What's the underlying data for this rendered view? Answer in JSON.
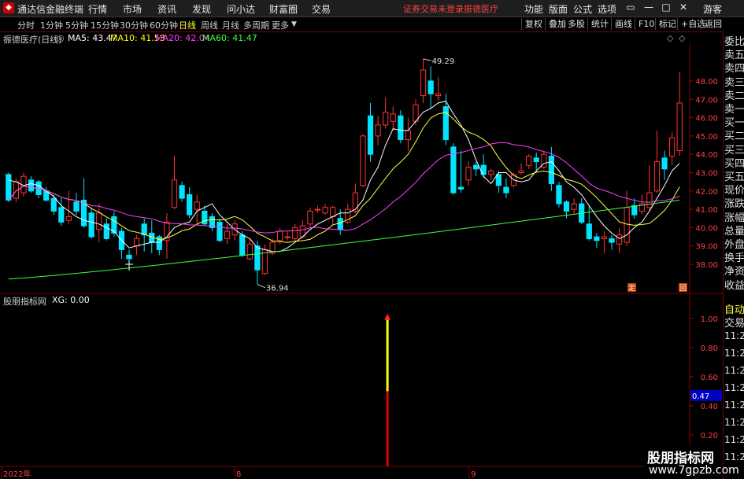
{
  "titlebar": {
    "app_name": "通达信金融终端",
    "menus": [
      "行情",
      "市场",
      "资讯",
      "发现",
      "问小达",
      "财富圈",
      "交易"
    ],
    "warning": "证券交易未登录",
    "stock_name": "振德医疗",
    "right_menus": [
      "功能",
      "版面",
      "公式",
      "选项"
    ],
    "user": "游客"
  },
  "tabs": {
    "periods": [
      "分时",
      "1分钟",
      "5分钟",
      "15分钟",
      "30分钟",
      "60分钟",
      "日线",
      "周线",
      "月线",
      "多周期",
      "更多"
    ],
    "active": "日线",
    "buttons": [
      "复权",
      "叠加",
      "多股",
      "统计",
      "画线",
      "F10",
      "标记",
      "+自选",
      "返回"
    ]
  },
  "main_chart": {
    "stock_title": "振德医疗(日线)",
    "ma": [
      {
        "label": "MA5: 43.47",
        "color": "#ffffff"
      },
      {
        "label": "MA10: 41.53",
        "color": "#ffff00"
      },
      {
        "label": "MA20: 42.04",
        "color": "#ff40ff"
      },
      {
        "label": "MA60: 41.47",
        "color": "#40ff40"
      }
    ],
    "high_label": "49.29",
    "low_label": "36.94",
    "badges": [
      "定",
      "回"
    ]
  },
  "sub_chart": {
    "title": "股朋指标网",
    "value_label": "XG: 0.00",
    "current_value": "0.47"
  },
  "date_axis": {
    "labels": [
      "2022年",
      "8",
      "9"
    ]
  },
  "right_panel": {
    "items": [
      "委比",
      "卖五",
      "卖四",
      "卖三",
      "卖二",
      "卖一",
      "买一",
      "买二",
      "买三",
      "买四",
      "买五",
      "现价",
      "涨跌",
      "涨幅",
      "总量",
      "外盘",
      "换手",
      "净资",
      "收益"
    ],
    "section_labels": [
      "自动",
      "交易"
    ],
    "times": [
      "11:29",
      "11:29",
      "11:29",
      "11:29",
      "11:29",
      "11:29",
      "11:29",
      "11:29"
    ]
  },
  "watermark": {
    "line1": "股朋指标网",
    "line2": "www.7gpzb.com"
  },
  "chart_data": [
    {
      "type": "candlestick",
      "title": "振德医疗(日线)",
      "y_ticks": [
        38.0,
        39.0,
        40.0,
        41.0,
        42.0,
        43.0,
        44.0,
        45.0,
        46.0,
        47.0,
        48.0
      ],
      "ylim": [
        36.5,
        49.8
      ],
      "candles": [
        [
          42.9,
          41.5,
          43.0,
          41.4
        ],
        [
          41.6,
          42.5,
          42.7,
          41.4
        ],
        [
          41.9,
          42.8,
          43.0,
          41.7
        ],
        [
          42.6,
          42.0,
          42.8,
          41.9
        ],
        [
          42.5,
          41.8,
          42.6,
          41.6
        ],
        [
          42.0,
          41.5,
          42.2,
          41.4
        ],
        [
          41.6,
          40.9,
          41.8,
          40.7
        ],
        [
          41.1,
          40.3,
          41.6,
          40.1
        ],
        [
          40.4,
          40.6,
          42.0,
          40.2
        ],
        [
          41.4,
          40.9,
          41.9,
          40.7
        ],
        [
          41.5,
          40.1,
          42.7,
          40.0
        ],
        [
          40.8,
          39.5,
          41.1,
          39.4
        ],
        [
          39.9,
          40.8,
          41.3,
          39.2
        ],
        [
          40.2,
          39.4,
          40.5,
          39.3
        ],
        [
          40.6,
          39.7,
          40.9,
          39.5
        ],
        [
          39.8,
          38.8,
          40.0,
          38.3
        ],
        [
          38.5,
          38.3,
          38.8,
          38.0
        ],
        [
          39.0,
          39.4,
          39.6,
          38.5
        ],
        [
          40.2,
          39.6,
          40.5,
          38.7
        ],
        [
          39.7,
          39.2,
          40.4,
          38.6
        ],
        [
          39.5,
          38.8,
          39.6,
          38.5
        ],
        [
          39.3,
          40.3,
          40.8,
          38.3
        ],
        [
          41.1,
          42.6,
          43.9,
          41.0
        ],
        [
          42.3,
          41.6,
          42.5,
          41.4
        ],
        [
          41.8,
          40.7,
          42.2,
          40.5
        ],
        [
          41.0,
          41.4,
          41.8,
          40.2
        ],
        [
          40.9,
          40.2,
          41.2,
          40.1
        ],
        [
          40.6,
          40.0,
          40.8,
          39.8
        ],
        [
          40.3,
          39.3,
          40.5,
          39.2
        ],
        [
          39.4,
          39.8,
          40.2,
          39.1
        ],
        [
          39.6,
          40.2,
          40.4,
          39.3
        ],
        [
          39.6,
          38.5,
          39.8,
          38.4
        ],
        [
          38.3,
          39.1,
          39.4,
          38.2
        ],
        [
          39.0,
          37.7,
          39.3,
          36.9
        ],
        [
          37.5,
          38.8,
          39.1,
          37.4
        ],
        [
          38.6,
          39.2,
          39.4,
          38.5
        ],
        [
          39.3,
          39.8,
          40.0,
          39.1
        ],
        [
          39.5,
          39.5,
          39.8,
          39.3
        ],
        [
          39.4,
          40.0,
          40.2,
          39.2
        ],
        [
          39.5,
          40.1,
          40.4,
          39.4
        ],
        [
          40.2,
          40.9,
          41.1,
          40.0
        ],
        [
          41.0,
          41.0,
          41.2,
          40.8
        ],
        [
          40.8,
          41.1,
          41.3,
          40.7
        ],
        [
          40.6,
          41.1,
          41.2,
          40.1
        ],
        [
          40.5,
          39.9,
          41.0,
          39.6
        ],
        [
          40.3,
          41.0,
          41.3,
          40.2
        ],
        [
          40.9,
          41.9,
          42.4,
          40.8
        ],
        [
          42.3,
          45.0,
          45.1,
          42.2
        ],
        [
          46.1,
          44.0,
          46.8,
          43.6
        ],
        [
          45.0,
          45.6,
          46.1,
          44.5
        ],
        [
          45.6,
          46.3,
          47.1,
          45.4
        ],
        [
          45.8,
          46.2,
          46.6,
          45.3
        ],
        [
          46.1,
          44.8,
          46.4,
          44.6
        ],
        [
          44.8,
          45.3,
          46.0,
          44.2
        ],
        [
          45.8,
          46.7,
          47.0,
          45.6
        ],
        [
          47.2,
          48.6,
          49.2,
          46.8
        ],
        [
          48.0,
          47.3,
          48.8,
          46.5
        ],
        [
          47.2,
          47.3,
          48.2,
          46.9
        ],
        [
          46.6,
          44.8,
          47.3,
          44.5
        ],
        [
          44.4,
          41.9,
          44.6,
          41.8
        ],
        [
          42.2,
          42.1,
          44.2,
          41.9
        ],
        [
          42.6,
          43.3,
          43.6,
          42.3
        ],
        [
          43.4,
          43.2,
          43.6,
          42.8
        ],
        [
          43.4,
          42.9,
          44.0,
          42.7
        ],
        [
          42.9,
          43.1,
          43.2,
          42.6
        ],
        [
          42.9,
          42.3,
          43.1,
          41.9
        ],
        [
          42.2,
          41.9,
          42.7,
          41.6
        ],
        [
          42.3,
          42.9,
          43.0,
          42.2
        ],
        [
          43.0,
          43.1,
          43.5,
          42.9
        ],
        [
          43.4,
          43.9,
          44.0,
          43.2
        ],
        [
          43.8,
          43.6,
          44.1,
          43.0
        ],
        [
          43.3,
          44.0,
          44.2,
          43.2
        ],
        [
          43.9,
          42.4,
          44.4,
          42.0
        ],
        [
          42.3,
          41.3,
          42.5,
          41.1
        ],
        [
          41.4,
          40.9,
          41.5,
          40.5
        ],
        [
          41.0,
          41.3,
          41.6,
          40.7
        ],
        [
          41.3,
          40.3,
          41.6,
          40.2
        ],
        [
          40.2,
          39.4,
          41.2,
          39.3
        ],
        [
          39.5,
          39.3,
          39.7,
          38.9
        ],
        [
          39.4,
          39.5,
          39.8,
          38.6
        ],
        [
          39.4,
          39.2,
          39.6,
          38.8
        ],
        [
          39.1,
          39.6,
          40.0,
          38.6
        ],
        [
          39.2,
          41.1,
          42.0,
          39.0
        ],
        [
          41.2,
          40.7,
          41.6,
          40.5
        ],
        [
          40.9,
          41.3,
          41.8,
          40.7
        ],
        [
          41.1,
          41.9,
          43.4,
          40.9
        ],
        [
          42.0,
          43.6,
          45.3,
          41.9
        ],
        [
          43.8,
          43.2,
          44.2,
          42.6
        ],
        [
          43.9,
          44.9,
          45.2,
          43.4
        ],
        [
          44.2,
          46.8,
          48.5,
          43.9
        ]
      ],
      "ma_values": {
        "MA5": [
          42.6,
          42.5,
          42.3,
          42.4,
          42.3,
          42.0,
          41.7,
          41.2,
          40.9,
          40.6,
          40.4,
          40.3,
          40.2,
          40.0,
          39.8,
          39.3,
          38.9,
          39.0,
          39.1,
          39.2,
          39.2,
          39.5,
          40.0,
          40.2,
          40.3,
          40.9,
          41.1,
          41.3,
          40.7,
          40.3,
          39.9,
          39.6,
          39.4,
          38.9,
          38.8,
          38.7,
          38.7,
          38.9,
          39.2,
          39.5,
          39.9,
          40.2,
          40.4,
          40.6,
          40.8,
          40.8,
          41.0,
          41.5,
          42.6,
          43.3,
          44.5,
          45.4,
          45.3,
          45.3,
          45.8,
          46.3,
          46.5,
          46.8,
          46.9,
          46.2,
          45.6,
          44.8,
          43.7,
          42.8,
          42.4,
          43.0,
          43.0,
          42.6,
          42.5,
          42.6,
          43.1,
          43.5,
          43.6,
          43.1,
          42.5,
          42.2,
          41.8,
          41.2,
          40.6,
          40.1,
          39.7,
          39.4,
          39.6,
          40.0,
          40.3,
          40.9,
          41.6,
          42.3,
          43.1,
          43.5
        ]
      }
    },
    {
      "type": "bar",
      "title": "股朋指标网",
      "y_ticks": [
        0.2,
        0.4,
        0.6,
        0.8,
        1.0
      ],
      "ylim": [
        0,
        1.15
      ],
      "signal": {
        "index": 49,
        "value": 1.0,
        "label": "XG: 0.00"
      }
    }
  ]
}
